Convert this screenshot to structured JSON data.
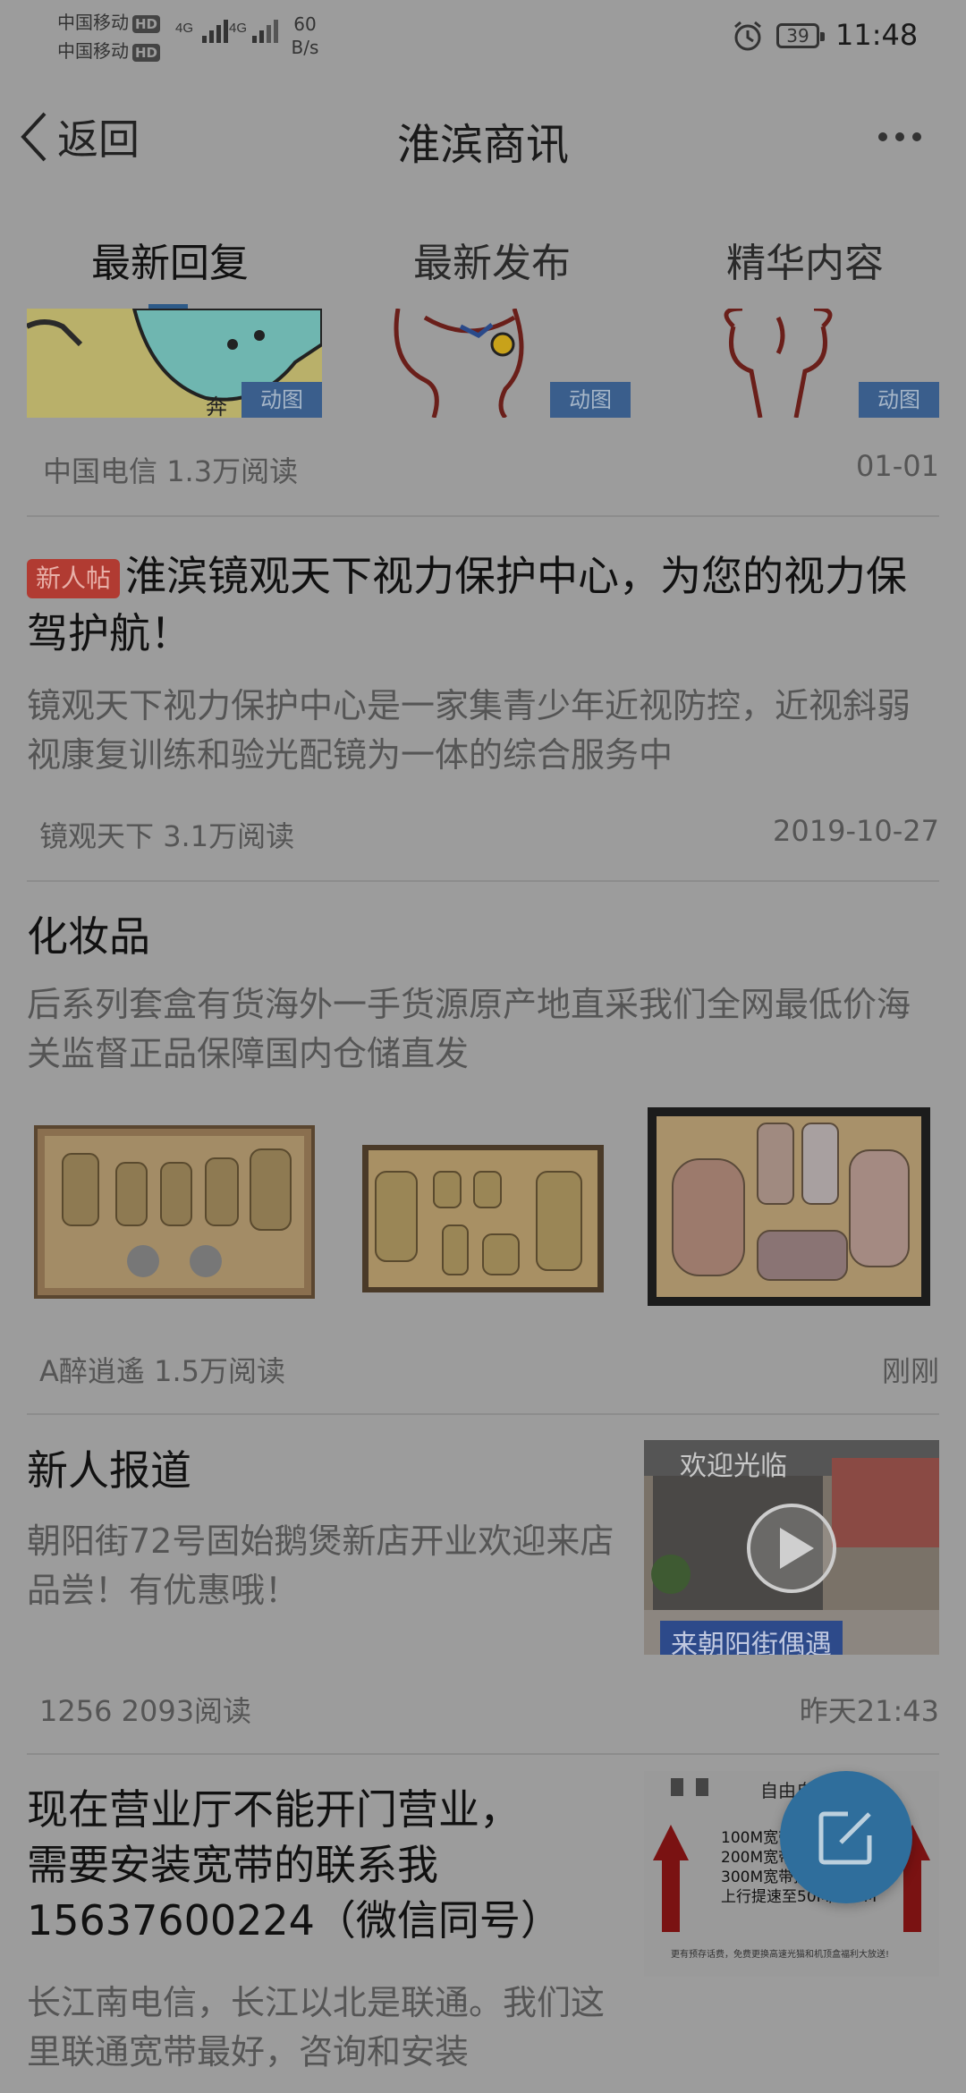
{
  "status_bar": {
    "carrier1": "中国移动",
    "carrier2": "中国移动",
    "hd": "HD",
    "net1": "4G",
    "net2": "4G",
    "speed_value": "60",
    "speed_unit": "B/s",
    "battery": "39",
    "time": "11:48"
  },
  "header": {
    "back_label": "返回",
    "title": "淮滨商讯",
    "more_icon": "more-dots-icon"
  },
  "tabs": [
    {
      "label": "最新回复",
      "active": true
    },
    {
      "label": "最新发布",
      "active": false
    },
    {
      "label": "精华内容",
      "active": false
    }
  ],
  "gif_badge": "动图",
  "post0": {
    "author": "中国电信",
    "reads": "1.3万阅读",
    "date": "01-01"
  },
  "post1": {
    "tag": "新人帖",
    "title": "淮滨镜观天下视力保护中心，为您的视力保驾护航！",
    "desc": "镜观天下视力保护中心是一家集青少年近视防控，近视斜弱视康复训练和验光配镜为一体的综合服务中",
    "author": "镜观天下",
    "reads": "3.1万阅读",
    "date": "2019-10-27"
  },
  "post2": {
    "title": "化妆品",
    "desc": "后系列套盒有货海外一手货源原产地直采我们全网最低价海关监督正品保障国内仓储直发",
    "author": "A醉逍遙",
    "reads": "1.5万阅读",
    "date": "刚刚"
  },
  "post3": {
    "title": "新人报道",
    "desc": "朝阳街72号固始鹅煲新店开业欢迎来店品尝！有优惠哦！",
    "author": "1256",
    "reads": "2093阅读",
    "date": "昨天21:43",
    "thumb_sign": "欢迎光临",
    "thumb_banner": "来朝阳街偶遇"
  },
  "post4": {
    "title_l1": "现在营业厅不能开门营业，",
    "title_l2": "需要安装宽带的联系我",
    "title_l3": "15637600224（微信同号）",
    "desc": "长江南电信，长江以北是联通。我们这里联通宽带最好，咨询和安装",
    "thumb_head": "自由自",
    "thumb_lines": [
      "100M宽带",
      "200M宽带提",
      "300M宽带提速到500M",
      "上行提速至50M/100M"
    ],
    "thumb_foot": "更有预存话费，免费更换高速光猫和机顶盒福利大放送!"
  },
  "colors": {
    "accent": "#2f6e9c",
    "tag_red": "#b13b32"
  }
}
